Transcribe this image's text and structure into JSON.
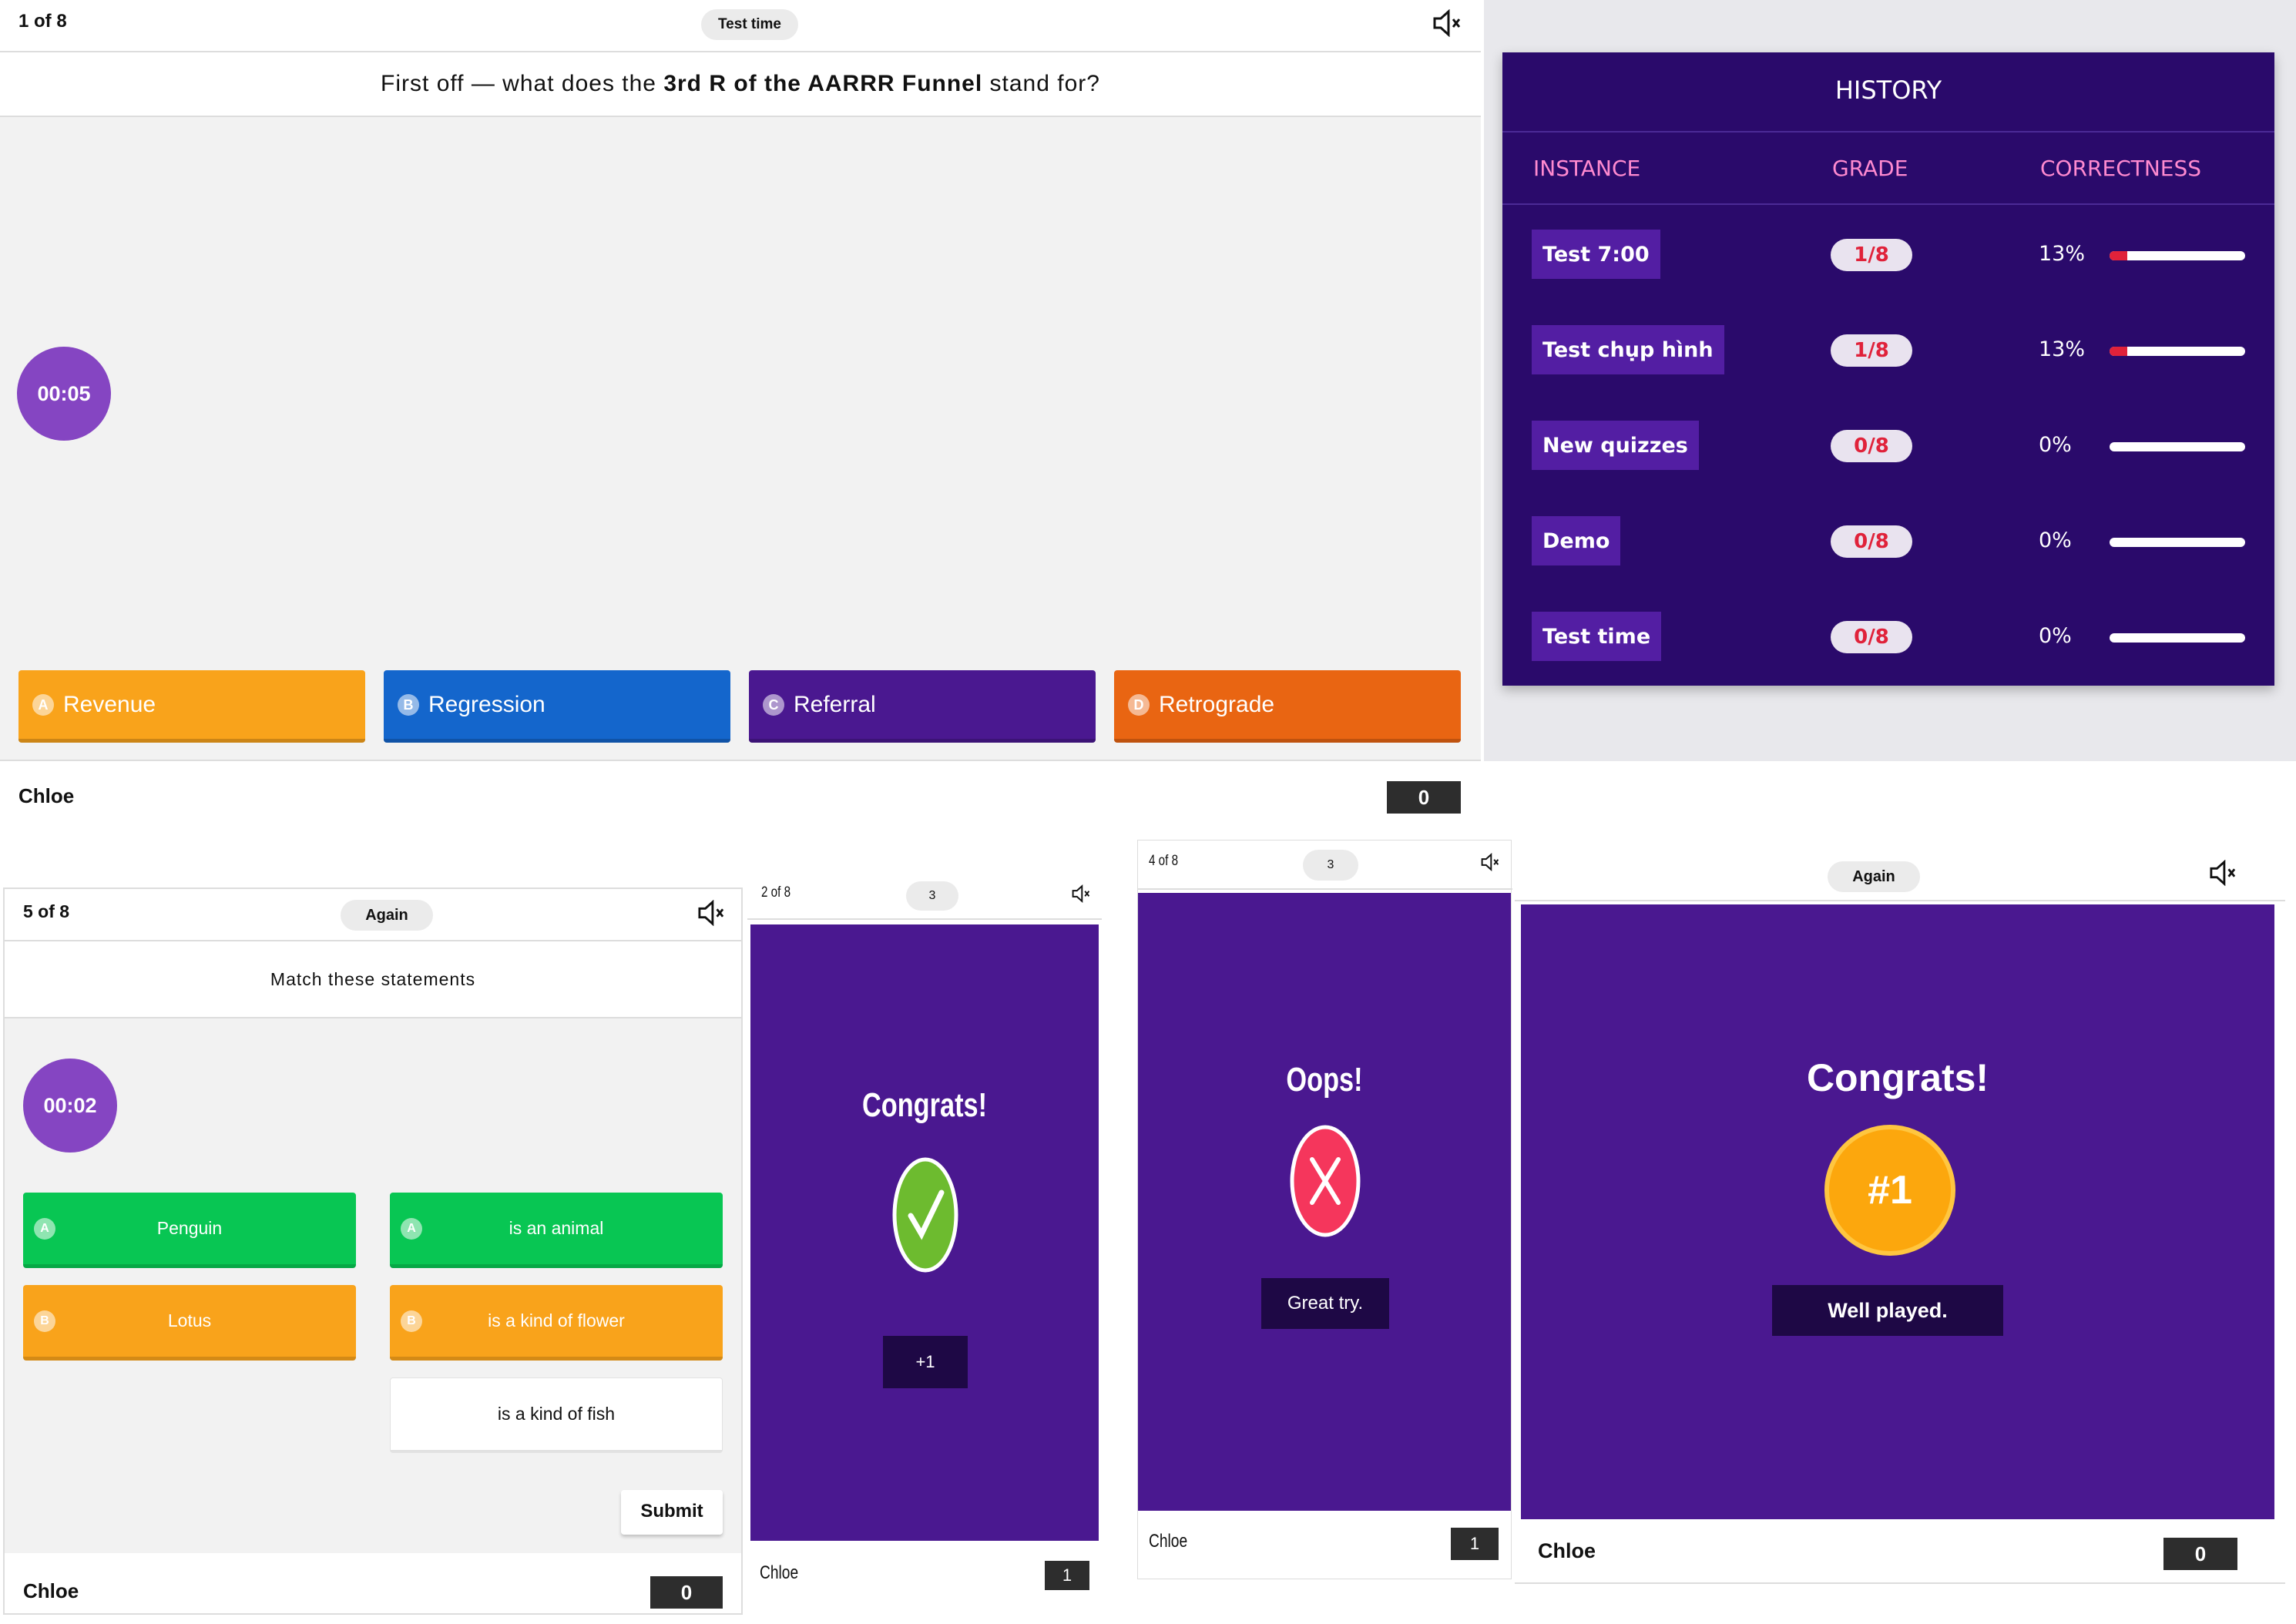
{
  "panel1": {
    "counter": "1 of 8",
    "test_name": "Test time",
    "question_prefix": "First off — what does the ",
    "question_bold": "3rd R of the AARRR Funnel",
    "question_suffix": " stand for?",
    "timer": "00:05",
    "answers": [
      {
        "letter": "A",
        "label": "Revenue",
        "color": "#f9a31b"
      },
      {
        "letter": "B",
        "label": "Regression",
        "color": "#1466cc"
      },
      {
        "letter": "C",
        "label": "Referral",
        "color": "#4a1890"
      },
      {
        "letter": "D",
        "label": "Retrograde",
        "color": "#e96512"
      }
    ],
    "player": "Chloe",
    "score": "0"
  },
  "history": {
    "title": "HISTORY",
    "columns": [
      "INSTANCE",
      "GRADE",
      "CORRECTNESS"
    ],
    "rows": [
      {
        "instance": "Test 7:00",
        "grade": "1/8",
        "correctness": "13%",
        "fraction": 0.13
      },
      {
        "instance": "Test chụp hình",
        "grade": "1/8",
        "correctness": "13%",
        "fraction": 0.13
      },
      {
        "instance": "New quizzes",
        "grade": "0/8",
        "correctness": "0%",
        "fraction": 0
      },
      {
        "instance": "Demo",
        "grade": "0/8",
        "correctness": "0%",
        "fraction": 0
      },
      {
        "instance": "Test time",
        "grade": "0/8",
        "correctness": "0%",
        "fraction": 0
      }
    ],
    "colors": {
      "bg": "#2a0a6b",
      "header_text": "#ff8ad0",
      "bar": "#e0223a"
    }
  },
  "panel2": {
    "counter": "5 of 8",
    "test_name": "Again",
    "question": "Match these statements",
    "timer": "00:02",
    "left": [
      {
        "letter": "A",
        "label": "Penguin",
        "color": "#08c653"
      },
      {
        "letter": "B",
        "label": "Lotus",
        "color": "#f9a31b"
      }
    ],
    "right": [
      {
        "letter": "A",
        "label": "is an animal",
        "color": "#08c653"
      },
      {
        "letter": "B",
        "label": "is a kind of flower",
        "color": "#f9a31b"
      },
      {
        "letter": "",
        "label": "is a kind of fish",
        "color": "#ffffff"
      }
    ],
    "submit": "Submit",
    "player": "Chloe",
    "score": "0"
  },
  "panel3": {
    "counter": "2 of 8",
    "test_name": "3",
    "heading": "Congrats!",
    "points": "+1",
    "player": "Chloe",
    "score": "1"
  },
  "panel4": {
    "counter": "4 of 8",
    "test_name": "3",
    "heading": "Oops!",
    "message": "Great try.",
    "player": "Chloe",
    "score": "1"
  },
  "panel5": {
    "test_name": "Again",
    "heading": "Congrats!",
    "rank": "#1",
    "message": "Well played.",
    "player": "Chloe",
    "score": "0"
  },
  "icons": {
    "mute": "speaker-muted-icon",
    "check": "check-icon",
    "cross": "x-icon"
  }
}
